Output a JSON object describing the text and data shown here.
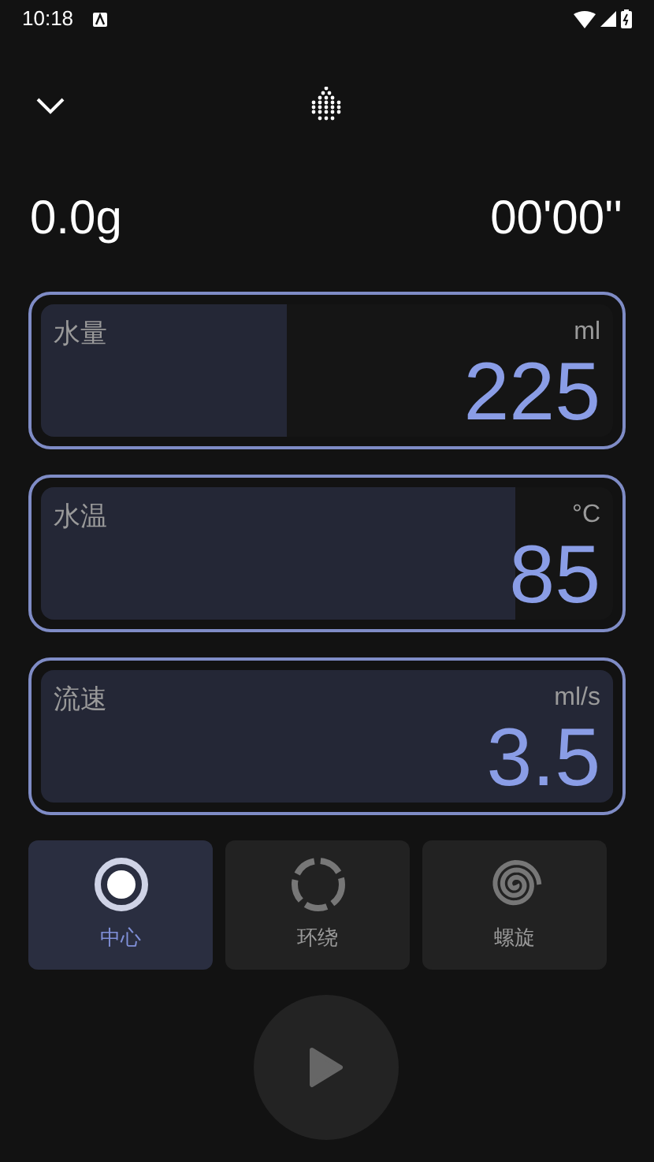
{
  "status_bar": {
    "time": "10:18"
  },
  "readouts": {
    "weight": "0.0g",
    "timer": "00'00''"
  },
  "params": [
    {
      "label": "水量",
      "unit": "ml",
      "value": "225",
      "level": 0.43
    },
    {
      "label": "水温",
      "unit": "°C",
      "value": "85",
      "level": 0.83
    },
    {
      "label": "流速",
      "unit": "ml/s",
      "value": "3.5",
      "level": 1.0
    }
  ],
  "modes": [
    {
      "kind": "center",
      "label": "中心",
      "selected": true
    },
    {
      "kind": "orbit",
      "label": "环绕",
      "selected": false
    },
    {
      "kind": "spiral",
      "label": "螺旋",
      "selected": false
    }
  ]
}
